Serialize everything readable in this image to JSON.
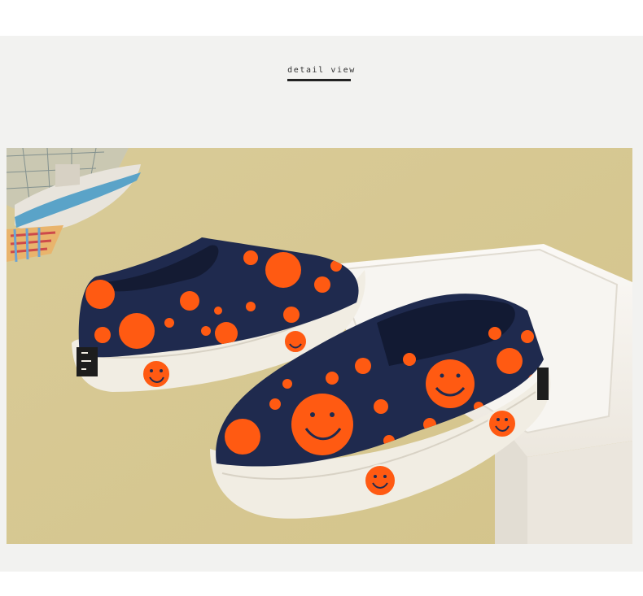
{
  "header": {
    "title": "detail view"
  },
  "photo": {
    "subject": "photo",
    "colors": {
      "background": "#d8cb95",
      "canvas": "#1f2a4e",
      "smiley": "#ff5a12",
      "sole": "#f1ede3",
      "box": "#f4f1ec"
    }
  }
}
